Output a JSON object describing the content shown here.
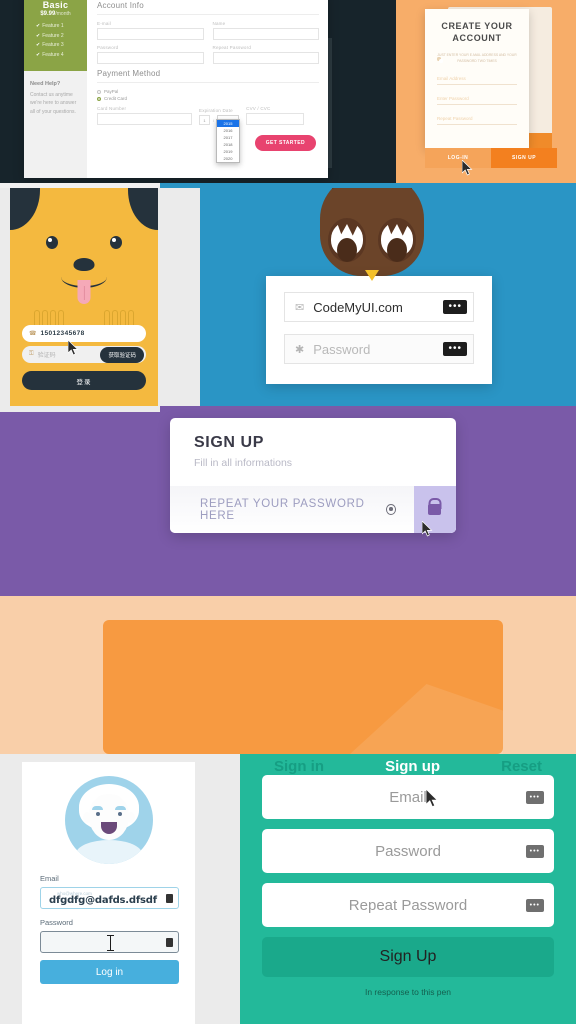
{
  "section_signup_form": {
    "plan": {
      "name": "Basic",
      "price": "$9.99",
      "per": "/month",
      "features": [
        "Feature 1",
        "Feature 2",
        "Feature 3",
        "Feature 4"
      ],
      "check_glyph": "✔",
      "bullet_glyph": "✔",
      "color": "#8ba446"
    },
    "help": {
      "title": "Need Help?",
      "body": "Contact us anytime we're here to answer all of your questions."
    },
    "account_info": {
      "title": "Account Info",
      "fields": [
        {
          "label": "E-mail",
          "value": ""
        },
        {
          "label": "Name",
          "value": ""
        },
        {
          "label": "Password",
          "value": ""
        },
        {
          "label": "Repeat Password",
          "value": ""
        }
      ]
    },
    "payment": {
      "title": "Payment Method",
      "options": [
        {
          "label": "PayPal",
          "selected": false
        },
        {
          "label": "Credit Card",
          "selected": true
        }
      ],
      "card_number_label": "Card Number",
      "expiration_label": "Expiration Date",
      "cvv_label": "CVV / CVC",
      "exp_month": "1",
      "exp_year": "2015",
      "year_options": [
        "2015",
        "2016",
        "2017",
        "2018",
        "2019",
        "2020"
      ],
      "selected_year": "2015"
    },
    "submit_label": "GET STARTED",
    "submit_color": "#e8436f"
  },
  "section_create_account": {
    "title": "CREATE YOUR ACCOUNT",
    "subtitle": "JUST ENTER YOUR E-MAIL ADDRESS AND YOUR PASSWORD TWO TIMES",
    "fields": [
      {
        "placeholder": "Email Address"
      },
      {
        "placeholder": "Enter Password"
      },
      {
        "placeholder": "Repeat Password"
      }
    ],
    "login_label": "LOG-IN",
    "signup_label": "SIGN UP",
    "bg_color": "#f7ad69",
    "signup_color": "#f3801f"
  },
  "section_dog_login": {
    "phone_value": "15012345678",
    "code_placeholder": "验证码",
    "get_code_label": "获取验证码",
    "login_label": "登录",
    "phone_icon": "☎",
    "lock_icon": "⚿",
    "bg_color": "#f4b93f"
  },
  "section_owl_login": {
    "email_value": "CodeMyUI.com",
    "password_placeholder": "Password",
    "email_icon": "✉",
    "password_icon": "✱",
    "dots": "•••",
    "bg_color": "#2a95c5"
  },
  "section_signup_purple": {
    "title": "SIGN UP",
    "subtitle": "Fill in all informations",
    "field_placeholder": "REPEAT YOUR PASSWORD HERE",
    "bg_color": "#7a5aa8",
    "lock_bg": "#c9c2ec"
  },
  "section_orange_card": {
    "bg_color": "#f9cfa9",
    "card_color": "#f79a41"
  },
  "section_blue_login": {
    "email_label": "Email",
    "email_ghost": "who@where.com",
    "email_value": "dfgdfg@dafds.dfsdf",
    "password_label": "Password",
    "password_value": "",
    "login_label": "Log in",
    "button_color": "#47afdd"
  },
  "section_teal_signup": {
    "tabs": [
      {
        "label": "Sign in",
        "active": false
      },
      {
        "label": "Sign up",
        "active": true
      },
      {
        "label": "Reset",
        "active": false
      }
    ],
    "fields": [
      {
        "placeholder": "Email"
      },
      {
        "placeholder": "Password"
      },
      {
        "placeholder": "Repeat Password"
      }
    ],
    "submit_label": "Sign Up",
    "footer": "In response to this pen",
    "dots": "•••",
    "bg_color": "#23b99a"
  }
}
